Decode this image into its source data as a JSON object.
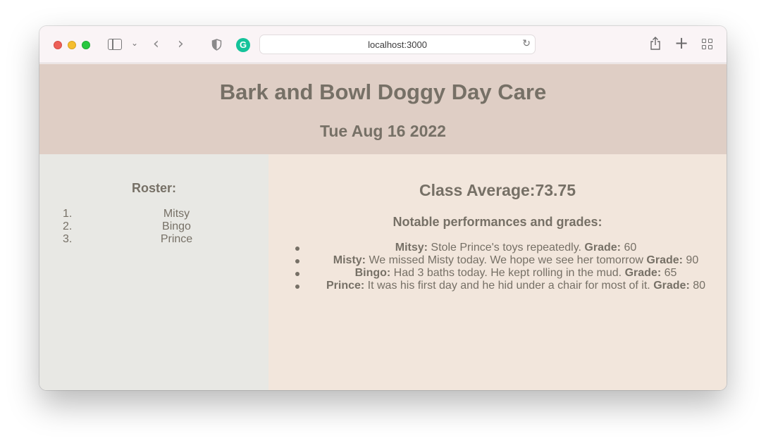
{
  "browser": {
    "url": "localhost:3000"
  },
  "header": {
    "title": "Bark and Bowl Doggy Day Care",
    "date": "Tue Aug 16 2022"
  },
  "roster": {
    "heading": "Roster:",
    "items": [
      {
        "num": "1.",
        "name": "Mitsy"
      },
      {
        "num": "2.",
        "name": "Bingo"
      },
      {
        "num": "3.",
        "name": "Prince"
      }
    ]
  },
  "performance": {
    "class_average": "Class Average:73.75",
    "heading": "Notable performances and grades:",
    "grade_label": "Grade:",
    "items": [
      {
        "name": "Mitsy:",
        "note": " Stole Prince's toys repeatedly.",
        "grade": "60"
      },
      {
        "name": "Misty:",
        "note": " We missed Misty today. We hope we see her tomorrow",
        "grade": "90"
      },
      {
        "name": "Bingo:",
        "note": " Had 3 baths today. He kept rolling in the mud.",
        "grade": "65"
      },
      {
        "name": "Prince:",
        "note": " It was his first day and he hid under a chair for most of it.",
        "grade": "80"
      }
    ]
  },
  "colors": {
    "header_bg": "#dfcec5",
    "left_bg": "#e8e8e4",
    "right_bg": "#f2e6dc",
    "text": "#767066"
  }
}
